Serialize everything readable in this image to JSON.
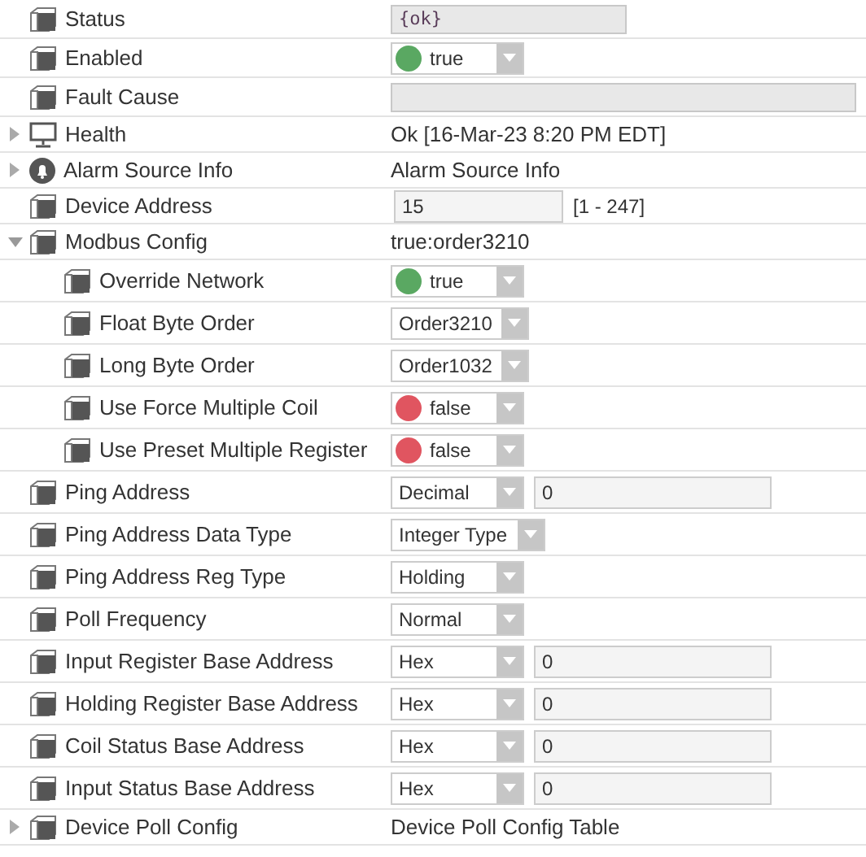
{
  "properties": [
    {
      "label": "Status",
      "kind": "readonly",
      "value": "{ok}"
    },
    {
      "label": "Enabled",
      "kind": "bool",
      "value": "true",
      "color": "#5aa862"
    },
    {
      "label": "Fault Cause",
      "kind": "readonly"
    },
    {
      "label": "Health",
      "expanded": false,
      "kind": "text",
      "value": "Ok [16-Mar-23 8:20 PM EDT]"
    },
    {
      "label": "Alarm Source Info",
      "expanded": false,
      "kind": "text",
      "value": "Alarm Source Info"
    },
    {
      "label": "Device Address",
      "kind": "number",
      "value": "15",
      "range": "[1 - 247]"
    },
    {
      "label": "Modbus Config",
      "expanded": true,
      "kind": "text",
      "value": "true:order3210",
      "children": [
        {
          "label": "Override Network",
          "kind": "bool",
          "value": "true",
          "color": "#5aa862"
        },
        {
          "label": "Float Byte Order",
          "kind": "select",
          "value": "Order3210"
        },
        {
          "label": "Long Byte Order",
          "kind": "select",
          "value": "Order1032"
        },
        {
          "label": "Use Force Multiple Coil",
          "kind": "bool",
          "value": "false",
          "color": "#e05560"
        },
        {
          "label": "Use Preset Multiple Register",
          "kind": "bool",
          "value": "false",
          "color": "#e05560"
        }
      ]
    },
    {
      "label": "Ping Address",
      "kind": "select-field",
      "value": "Decimal",
      "field": "0"
    },
    {
      "label": "Ping Address Data Type",
      "kind": "select",
      "value": "Integer Type"
    },
    {
      "label": "Ping Address Reg Type",
      "kind": "select",
      "value": "Holding"
    },
    {
      "label": "Poll Frequency",
      "kind": "select",
      "value": "Normal"
    },
    {
      "label": "Input Register Base Address",
      "kind": "select-field",
      "value": "Hex",
      "field": "0"
    },
    {
      "label": "Holding Register Base Address",
      "kind": "select-field",
      "value": "Hex",
      "field": "0"
    },
    {
      "label": "Coil Status Base Address",
      "kind": "select-field",
      "value": "Hex",
      "field": "0"
    },
    {
      "label": "Input Status Base Address",
      "kind": "select-field",
      "value": "Hex",
      "field": "0"
    },
    {
      "label": "Device Poll Config",
      "expanded": false,
      "kind": "text",
      "value": "Device Poll Config Table"
    }
  ]
}
